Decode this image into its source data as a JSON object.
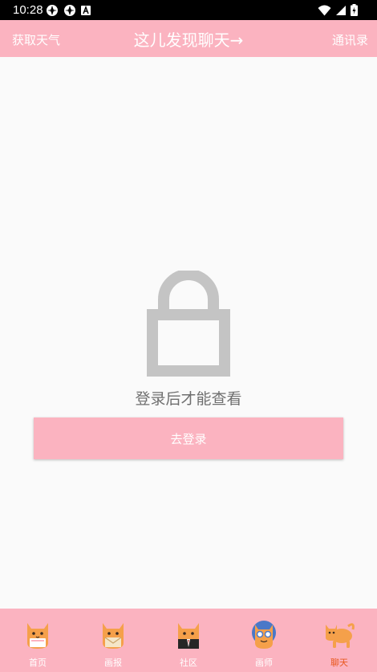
{
  "status_bar": {
    "time": "10:28"
  },
  "header": {
    "left_action": "获取天气",
    "title": "这儿发现聊天→",
    "right_action": "通讯录"
  },
  "main": {
    "lock_icon": "lock-icon",
    "message": "登录后才能查看",
    "login_button": "去登录"
  },
  "tabs": [
    {
      "label": "首页",
      "icon": "cat-letter-icon",
      "active": false
    },
    {
      "label": "画报",
      "icon": "cat-envelope-icon",
      "active": false
    },
    {
      "label": "社区",
      "icon": "cat-suit-icon",
      "active": false
    },
    {
      "label": "画师",
      "icon": "cat-goggles-icon",
      "active": false
    },
    {
      "label": "聊天",
      "icon": "cat-walking-icon",
      "active": true
    }
  ],
  "colors": {
    "accent": "#fbb3c0",
    "active_tab": "#e8581e",
    "lock": "#c4c4c4"
  }
}
